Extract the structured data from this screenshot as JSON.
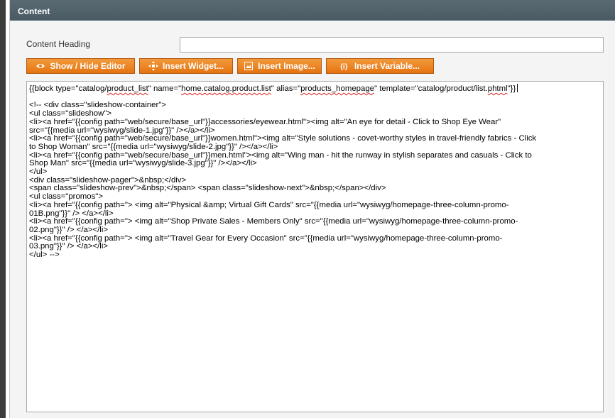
{
  "panel": {
    "title": "Content"
  },
  "heading": {
    "label": "Content Heading",
    "value": ""
  },
  "buttons": {
    "show_hide": "Show / Hide Editor",
    "insert_widget": "Insert Widget...",
    "insert_image": "Insert Image...",
    "insert_variable": "Insert Variable..."
  },
  "icons": {
    "show_hide": "eye-icon",
    "insert_widget": "widget-icon",
    "insert_image": "image-icon",
    "insert_variable": "variable-icon"
  },
  "colors": {
    "button_orange": "#e8802a",
    "header_bg": "#505f67",
    "spellcheck_red": "#e02020"
  },
  "editor": {
    "first_line_parts": [
      "{{block type=\"catalog/",
      "product_list",
      "\" name=\"",
      "home.catalog.product.list",
      "\" alias=\"",
      "products_homepage",
      "\" template=\"catalog/product/list.",
      "phtml",
      "\"}}"
    ],
    "lines": [
      "<!-- <div class=\"slideshow-container\">",
      "<ul class=\"slideshow\">",
      "<li><a href=\"{{config path=\"web/secure/base_url\"}}accessories/eyewear.html\"><img alt=\"An eye for detail - Click to Shop Eye Wear\"",
      "src=\"{{media url=\"wysiwyg/slide-1.jpg\"}}\" /></a></li>",
      "<li><a href=\"{{config path=\"web/secure/base_url\"}}women.html\"><img alt=\"Style solutions - covet-worthy styles in travel-friendly fabrics - Click",
      "to Shop Woman\" src=\"{{media url=\"wysiwyg/slide-2.jpg\"}}\" /></a></li>",
      "<li><a href=\"{{config path=\"web/secure/base_url\"}}men.html\"><img alt=\"Wing man - hit the runway in stylish separates and casuals - Click to",
      "Shop Man\" src=\"{{media url=\"wysiwyg/slide-3.jpg\"}}\" /></a></li>",
      "</ul>",
      "<div class=\"slideshow-pager\">&nbsp;</div>",
      "<span class=\"slideshow-prev\">&nbsp;</span> <span class=\"slideshow-next\">&nbsp;</span></div>",
      "<ul class=\"promos\">",
      "<li><a href=\"{{config path=\"> <img alt=\"Physical &amp; Virtual Gift Cards\" src=\"{{media url=\"wysiwyg/homepage-three-column-promo-",
      "01B.png\"}}\" /> </a></li>",
      "<li><a href=\"{{config path=\"> <img alt=\"Shop Private Sales - Members Only\" src=\"{{media url=\"wysiwyg/homepage-three-column-promo-",
      "02.png\"}}\" /> </a></li>",
      "<li><a href=\"{{config path=\"> <img alt=\"Travel Gear for Every Occasion\" src=\"{{media url=\"wysiwyg/homepage-three-column-promo-",
      "03.png\"}}\" /> </a></li>",
      "</ul> -->"
    ]
  }
}
